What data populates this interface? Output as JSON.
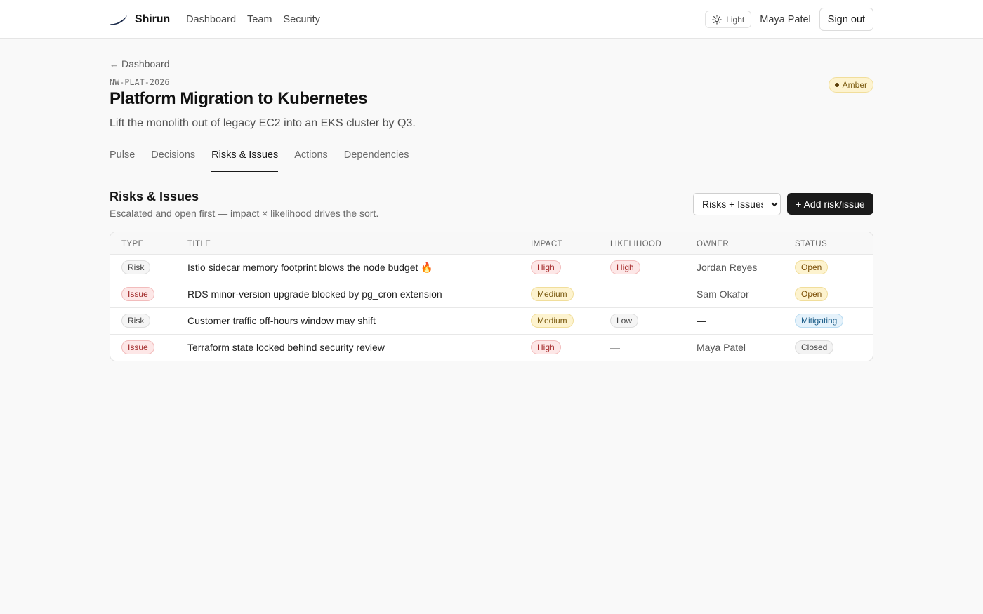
{
  "nav": {
    "brand": "Shirun",
    "links": [
      "Dashboard",
      "Team",
      "Security"
    ],
    "theme_label": "Light",
    "user_name": "Maya Patel",
    "signout_label": "Sign out"
  },
  "breadcrumb": {
    "back_label": "Dashboard",
    "arrow": "←"
  },
  "project": {
    "code": "NW-PLAT-2026",
    "title": "Platform Migration to Kubernetes",
    "subtitle": "Lift the monolith out of legacy EC2 into an EKS cluster by Q3.",
    "status": "Amber"
  },
  "tabs": [
    {
      "label": "Pulse",
      "active": false
    },
    {
      "label": "Decisions",
      "active": false
    },
    {
      "label": "Risks & Issues",
      "active": true
    },
    {
      "label": "Actions",
      "active": false
    },
    {
      "label": "Dependencies",
      "active": false
    }
  ],
  "section": {
    "title": "Risks & Issues",
    "description": "Escalated and open first — impact × likelihood drives the sort.",
    "filter_value": "Risks + Issues",
    "add_label": "+ Add risk/issue"
  },
  "table": {
    "headers": [
      "TYPE",
      "TITLE",
      "IMPACT",
      "LIKELIHOOD",
      "OWNER",
      "STATUS"
    ],
    "rows": [
      {
        "type": "Risk",
        "title": "Istio sidecar memory footprint blows the node budget",
        "title_emoji": "🔥",
        "impact": "High",
        "likelihood": "High",
        "owner": "Jordan Reyes",
        "status": "Open"
      },
      {
        "type": "Issue",
        "title": "RDS minor-version upgrade blocked by pg_cron extension",
        "title_emoji": "",
        "impact": "Medium",
        "likelihood": "—",
        "owner": "Sam Okafor",
        "status": "Open"
      },
      {
        "type": "Risk",
        "title": "Customer traffic off-hours window may shift",
        "title_emoji": "",
        "impact": "Medium",
        "likelihood": "Low",
        "owner": "—",
        "status": "Mitigating"
      },
      {
        "type": "Issue",
        "title": "Terraform state locked behind security review",
        "title_emoji": "",
        "impact": "High",
        "likelihood": "—",
        "owner": "Maya Patel",
        "status": "Closed"
      }
    ]
  },
  "colors": {
    "primary_button": "#1b1b1b",
    "amber_bg": "#fdf3cf",
    "danger_bg": "#fde7e7",
    "info_bg": "#e5f2fb"
  }
}
